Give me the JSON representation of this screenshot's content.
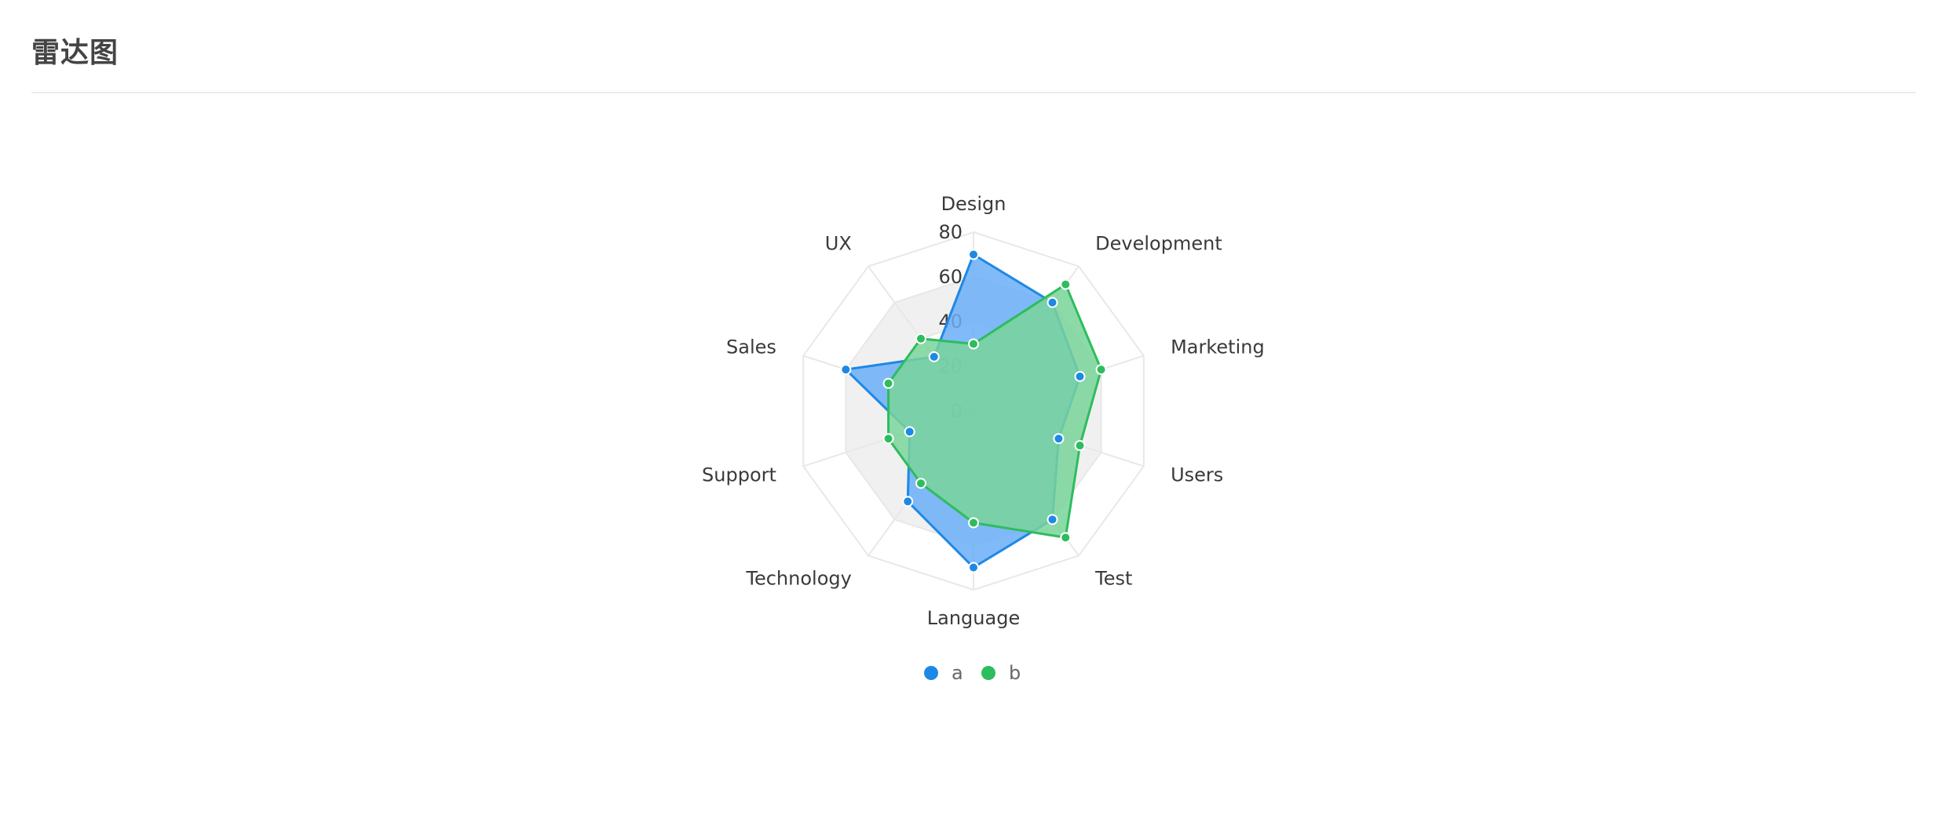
{
  "page": {
    "title": "雷达图"
  },
  "colors": {
    "grid": "#e8e8e8",
    "band": "#f0f0f0"
  },
  "chart_data": {
    "type": "radar",
    "title": "",
    "axes": [
      "Design",
      "Development",
      "Marketing",
      "Users",
      "Test",
      "Language",
      "Technology",
      "Support",
      "Sales",
      "UX"
    ],
    "ticks": [
      0,
      20,
      40,
      60,
      80
    ],
    "ylim": [
      0,
      80
    ],
    "grid": true,
    "legend_position": "bottom",
    "series": [
      {
        "name": "a",
        "color": "#1e88e5",
        "fill": "#6aaef7",
        "values": [
          70,
          60,
          50,
          40,
          60,
          70,
          50,
          30,
          60,
          30
        ]
      },
      {
        "name": "b",
        "color": "#2dbd5d",
        "fill": "#79d39a",
        "values": [
          30,
          70,
          60,
          50,
          70,
          50,
          40,
          40,
          40,
          40
        ]
      }
    ]
  }
}
